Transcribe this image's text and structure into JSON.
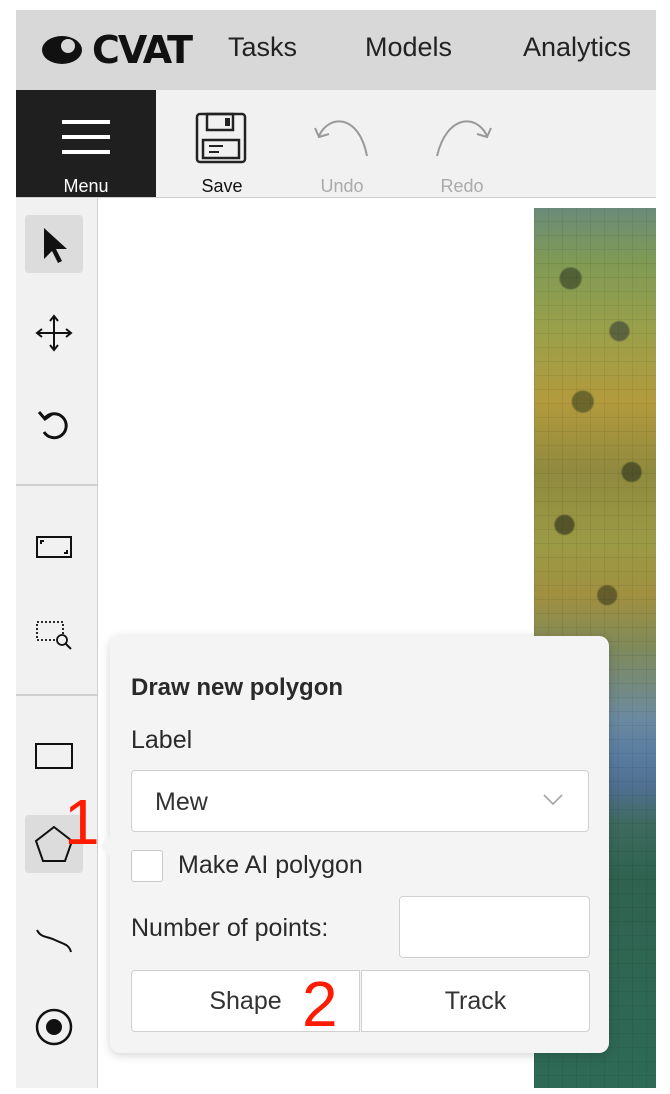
{
  "app": {
    "logo_text": "CVAT"
  },
  "nav": {
    "items": [
      "Tasks",
      "Models",
      "Analytics"
    ]
  },
  "toolbar": {
    "menu_label": "Menu",
    "save_label": "Save",
    "undo_label": "Undo",
    "redo_label": "Redo"
  },
  "sidebar": {
    "tools": [
      "cursor-icon",
      "move-icon",
      "rotate-icon",
      "fit-image-icon",
      "zoom-region-icon",
      "draw-rectangle-icon",
      "draw-polygon-icon",
      "draw-polyline-icon",
      "draw-points-icon"
    ],
    "active_tool": "cursor-icon",
    "selected_tool": "draw-polygon-icon"
  },
  "popover": {
    "title": "Draw new polygon",
    "label_heading": "Label",
    "label_value": "Mew",
    "ai_checkbox_label": "Make AI polygon",
    "ai_checked": false,
    "points_label": "Number of points:",
    "points_value": "",
    "shape_button": "Shape",
    "track_button": "Track"
  },
  "annotations": {
    "step1": "1",
    "step2": "2"
  },
  "colors": {
    "annotation": "#ff1a00",
    "menu_bg": "#1f1f1f",
    "toolbar_bg": "#f1f1f1",
    "nav_bg": "#d8d8d8"
  }
}
